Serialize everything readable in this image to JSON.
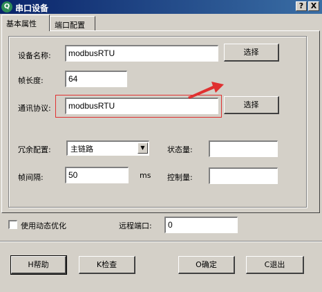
{
  "window": {
    "title": "串口设备",
    "icon": "app-logo-icon",
    "help_glyph": "?",
    "close_glyph": "X"
  },
  "tabs": [
    {
      "label": "基本属性",
      "active": true
    },
    {
      "label": "端口配置",
      "active": false
    }
  ],
  "form": {
    "device_name_label": "设备名称:",
    "device_name_value": "modbusRTU",
    "frame_length_label": "帧长度:",
    "frame_length_value": "64",
    "protocol_label": "通讯协议:",
    "protocol_value": "modbusRTU",
    "select_button_label": "选择",
    "redundancy_label": "冗余配置:",
    "redundancy_value": "主链路",
    "frame_interval_label": "帧间隔:",
    "frame_interval_value": "50",
    "frame_interval_unit": "ms",
    "status_var_label": "状态量:",
    "status_var_value": "",
    "control_var_label": "控制量:",
    "control_var_value": "",
    "dynamic_opt_label": "使用动态优化",
    "dynamic_opt_checked": false,
    "remote_port_label": "远程端口:",
    "remote_port_value": "0"
  },
  "buttons": {
    "help": "H帮助",
    "check": "K检查",
    "ok": "O确定",
    "cancel": "C退出"
  },
  "colors": {
    "annotation": "#e03030",
    "title_bar": "#0a246a"
  }
}
